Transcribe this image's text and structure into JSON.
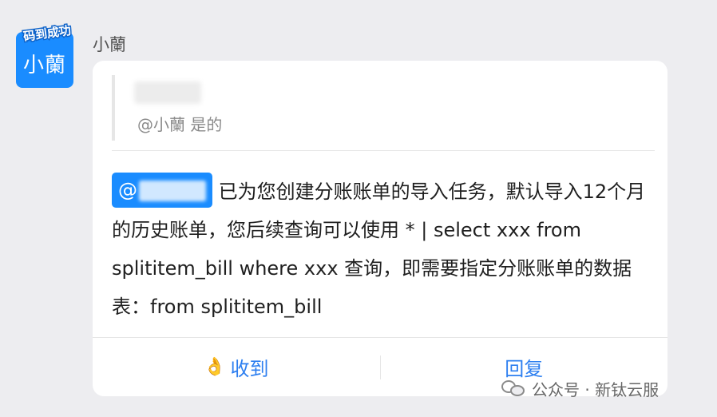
{
  "avatar": {
    "label": "小蘭",
    "badge": "码到成功"
  },
  "sender": {
    "name": "小蘭"
  },
  "quote": {
    "text": "@小蘭  是的"
  },
  "message": {
    "mention_prefix": "@",
    "text": "已为您创建分账账单的导入任务，默认导入12个月的历史账单，您后续查询可以使用 * | select xxx from splititem_bill where xxx  查询，即需要指定分账账单的数据表：from splititem_bill"
  },
  "actions": [
    {
      "label": "收到",
      "icon": "ok-hand-icon"
    },
    {
      "label": "回复"
    }
  ],
  "watermark": {
    "text": "公众号 · 新钛云服",
    "icon": "wechat-icon"
  },
  "colors": {
    "accent": "#1a8cff",
    "action_text": "#2d7ff0",
    "background": "#ededf0"
  }
}
